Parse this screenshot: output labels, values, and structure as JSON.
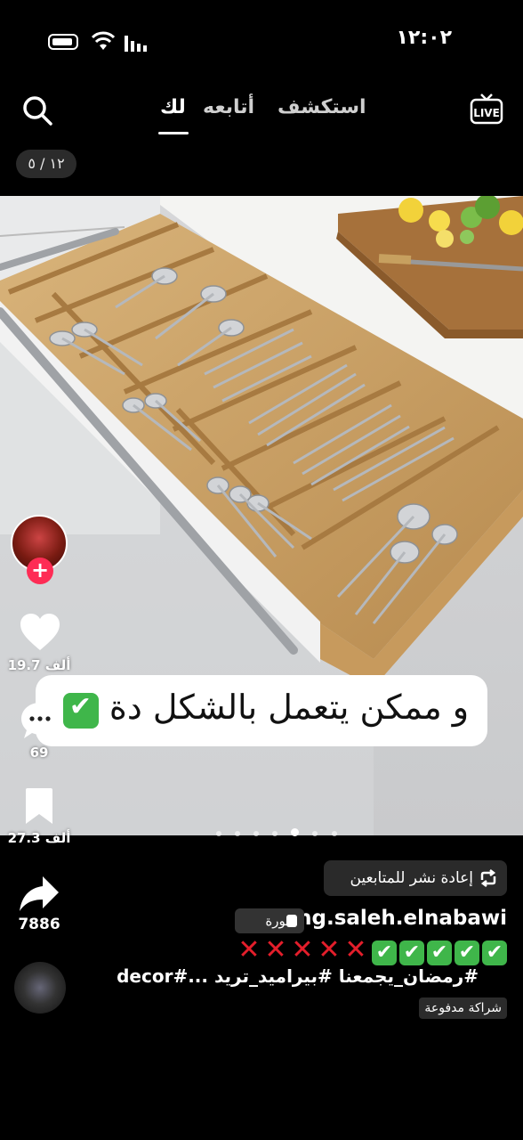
{
  "status_bar": {
    "time": "١٢:٠٢"
  },
  "top_nav": {
    "tabs": [
      {
        "label": "استكشف",
        "active": false
      },
      {
        "label": "أتابعه",
        "active": false
      },
      {
        "label": "لك",
        "active": true
      }
    ],
    "live_label": "LIVE",
    "page_counter": "١٢ / ٥"
  },
  "post": {
    "caption_overlay": "و ممكن يتعمل بالشكل دة",
    "carousel_dots": 7,
    "carousel_active_index": 4
  },
  "actions": {
    "likes": "19.7 ألف",
    "comments": "69",
    "bookmarks": "27.3 ألف",
    "shares": "7886"
  },
  "info": {
    "repost_label": "إعادة نشر للمتابعين",
    "username": "eng.saleh.elnabawi",
    "photo_tag": "صورة",
    "marks": {
      "x_count": 5,
      "check_count": 5
    },
    "hashtags": "#رمضان_يجمعنا #بيراميد_تريد ...#decor",
    "paid_partnership": "شراكة مدفوعة"
  },
  "colors": {
    "accent_red": "#fe2c55",
    "check_green": "#3fb64a",
    "x_red": "#e41e2b"
  }
}
